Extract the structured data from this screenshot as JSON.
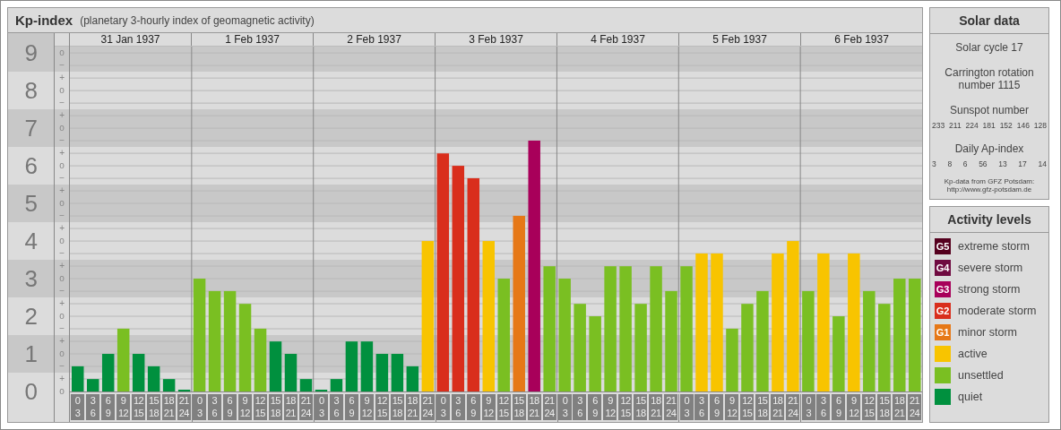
{
  "panel": {
    "title": "Kp-index",
    "subtitle": "(planetary 3-hourly index of geomagnetic activity)",
    "days": [
      "31 Jan 1937",
      "1 Feb 1937",
      "2 Feb 1937",
      "3 Feb 1937",
      "4 Feb 1937",
      "5 Feb 1937",
      "6 Feb 1937"
    ],
    "sublabels": [
      "o",
      "−",
      "+",
      "o",
      "−",
      "+",
      "o",
      "−",
      "+",
      "o",
      "−",
      "+",
      "o",
      "−",
      "+",
      "o",
      "−",
      "+",
      "o",
      "−",
      "+",
      "o",
      "−",
      "+",
      "o",
      "−",
      "+",
      "o"
    ],
    "chart_data": {
      "type": "bar",
      "ylim": [
        0,
        9.17
      ],
      "grid": true,
      "yticks": [
        {
          "value": 0,
          "label": "0"
        },
        {
          "value": 1,
          "label": "1"
        },
        {
          "value": 2,
          "label": "2"
        },
        {
          "value": 3,
          "label": "3"
        },
        {
          "value": 4,
          "label": "4"
        },
        {
          "value": 5,
          "label": "5"
        },
        {
          "value": 6,
          "label": "6"
        },
        {
          "value": 7,
          "label": "7"
        },
        {
          "value": 8,
          "label": "8"
        },
        {
          "value": 9,
          "label": "9"
        }
      ],
      "categories": [
        "0 3",
        "3 6",
        "6 9",
        "9 12",
        "12 15",
        "15 18",
        "18 21",
        "21 24",
        "0 3",
        "3 6",
        "6 9",
        "9 12",
        "12 15",
        "15 18",
        "18 21",
        "21 24",
        "0 3",
        "3 6",
        "6 9",
        "9 12",
        "12 15",
        "15 18",
        "18 21",
        "21 24",
        "0 3",
        "3 6",
        "6 9",
        "9 12",
        "12 15",
        "15 18",
        "18 21",
        "21 24",
        "0 3",
        "3 6",
        "6 9",
        "9 12",
        "12 15",
        "15 18",
        "18 21",
        "21 24",
        "0 3",
        "3 6",
        "6 9",
        "9 12",
        "12 15",
        "15 18",
        "18 21",
        "21 24",
        "0 3",
        "3 6",
        "6 9",
        "9 12",
        "12 15",
        "15 18",
        "18 21",
        "21 24"
      ],
      "values": [
        0.67,
        0.33,
        1,
        1.67,
        1,
        0.67,
        0.33,
        0,
        3,
        2.67,
        2.67,
        2.33,
        1.67,
        1.33,
        1,
        0.33,
        0,
        0.33,
        1.33,
        1.33,
        1,
        1,
        0.67,
        4,
        6.33,
        6,
        5.67,
        4,
        3,
        4.67,
        6.67,
        3.33,
        3,
        2.33,
        2,
        3.33,
        3.33,
        2.33,
        3.33,
        2.67,
        3.33,
        3.67,
        3.67,
        1.67,
        2.33,
        2.67,
        3.67,
        4,
        2.67,
        3.67,
        2,
        3.67,
        2.67,
        2.33,
        3,
        3
      ]
    }
  },
  "solar_data": {
    "title": "Solar data",
    "solar_cycle": "Solar cycle 17",
    "carrington": "Carrington rotation number 1115",
    "sunspot_label": "Sunspot number",
    "sunspot_values": [
      "233",
      "211",
      "224",
      "181",
      "152",
      "146",
      "128"
    ],
    "ap_label": "Daily Ap-index",
    "ap_values": [
      "3",
      "8",
      "6",
      "56",
      "13",
      "17",
      "14"
    ],
    "source_lines": [
      "Kp-data from GFZ Potsdam:",
      "http://www.gfz-potsdam.de"
    ]
  },
  "legend": {
    "title": "Activity levels",
    "items": [
      {
        "badge": "G5",
        "label": "extreme storm",
        "color": "#55001e"
      },
      {
        "badge": "G4",
        "label": "severe storm",
        "color": "#6f0a40"
      },
      {
        "badge": "G3",
        "label": "strong storm",
        "color": "#a8005a"
      },
      {
        "badge": "G2",
        "label": "moderate storm",
        "color": "#d92e1c"
      },
      {
        "badge": "G1",
        "label": "minor storm",
        "color": "#e67817"
      },
      {
        "label": "active",
        "color": "#f8c400"
      },
      {
        "label": "unsettled",
        "color": "#7abf22"
      },
      {
        "label": "quiet",
        "color": "#00903e"
      }
    ]
  }
}
